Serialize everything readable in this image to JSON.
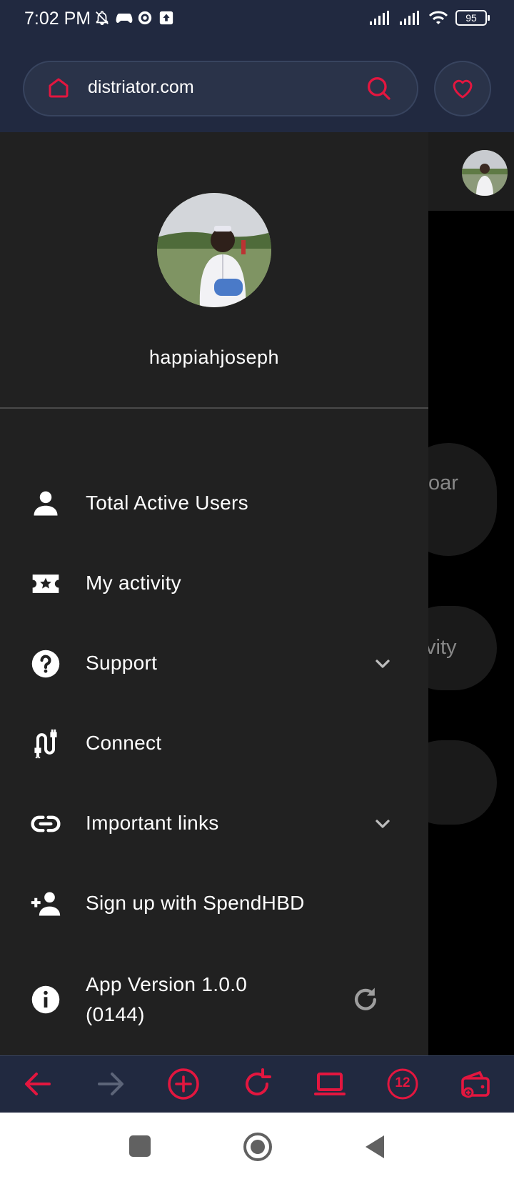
{
  "status_bar": {
    "time": "7:02 PM",
    "battery": "95"
  },
  "address_bar": {
    "url": "distriator.com"
  },
  "background_page": {
    "pill1_text": "oar",
    "pill2_text": "vity"
  },
  "drawer": {
    "username": "happiahjoseph",
    "items": [
      {
        "label": "Total Active Users",
        "icon": "person-icon"
      },
      {
        "label": "My activity",
        "icon": "ticket-star-icon"
      },
      {
        "label": "Support",
        "icon": "help-circle-icon"
      },
      {
        "label": "Connect",
        "icon": "cable-icon"
      },
      {
        "label": "Important links",
        "icon": "link-icon"
      },
      {
        "label": "Sign up with SpendHBD",
        "icon": "person-add-icon"
      }
    ],
    "app_version_line1": "App Version 1.0.0",
    "app_version_line2": "(0144)"
  },
  "toolbar": {
    "tab_count": "12"
  },
  "colors": {
    "accent": "#e3163f",
    "bar_bg": "#212940",
    "drawer_bg": "#212121"
  }
}
